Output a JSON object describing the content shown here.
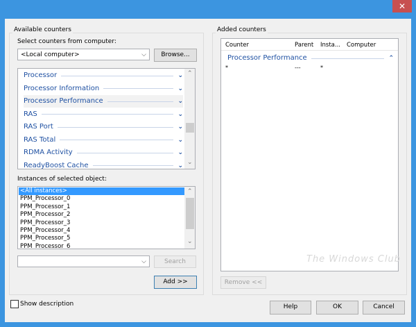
{
  "window": {
    "close_icon": "close-icon"
  },
  "available": {
    "group_label": "Available counters",
    "computer_label": "Select counters from computer:",
    "computer_value": "<Local computer>",
    "browse": "Browse...",
    "counters": [
      "Processor",
      "Processor Information",
      "Processor Performance",
      "RAS",
      "RAS Port",
      "RAS Total",
      "RDMA Activity",
      "ReadyBoost Cache"
    ],
    "instances_label": "Instances of selected object:",
    "instances": [
      "<All instances>",
      "PPM_Processor_0",
      "PPM_Processor_1",
      "PPM_Processor_2",
      "PPM_Processor_3",
      "PPM_Processor_4",
      "PPM_Processor_5",
      "PPM_Processor_6"
    ],
    "search_value": "",
    "search": "Search",
    "add": "Add >>"
  },
  "added": {
    "group_label": "Added counters",
    "columns": [
      "Counter",
      "Parent",
      "Insta...",
      "Computer"
    ],
    "group_name": "Processor Performance",
    "row": {
      "counter": "*",
      "parent": "---",
      "instance": "*",
      "computer": ""
    },
    "remove": "Remove <<"
  },
  "watermark": "The Windows Club",
  "footer": {
    "show_description": "Show description",
    "help": "Help",
    "ok": "OK",
    "cancel": "Cancel"
  }
}
